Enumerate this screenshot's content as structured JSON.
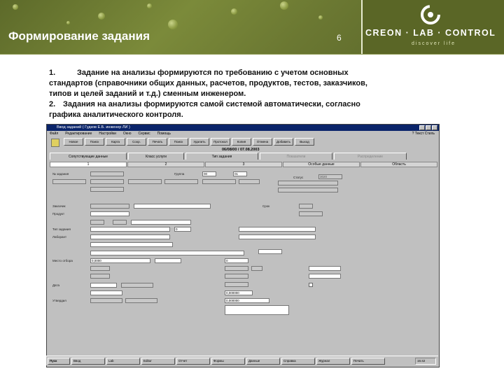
{
  "slide": {
    "title": "Формирование задания",
    "page_number": "6",
    "logo": "CREON · LAB · CONTROL",
    "logo_sub": "discover life",
    "item1_num": "1.",
    "item1_text": "Задание на анализы формируются по требованию с учетом основных стандартов (справочники общих данных, расчетов, продуктов, тестов, заказчиков, типов и целей заданий и т.д.) сменным инженером.",
    "item2_num": "2.",
    "item2_text": "Задания на анализы формируются самой системой автоматически, согласно графика аналитического контроля."
  },
  "app": {
    "window_title": "Ввод заданий ( Гудков Е.Б. инженер ЛИ )",
    "menu": [
      "Файл",
      "Редактирование",
      "Настройки",
      "Окно",
      "Сервис",
      "Помощь"
    ],
    "menu_right": "? Текст  Стиль",
    "toolbar": [
      "Новое",
      "Поиск",
      "Карта",
      "Сохр.",
      "Печать",
      "Поиск",
      "Удалить",
      "Протокол",
      "Копия",
      "Отмена",
      "Добавить",
      "Выход"
    ],
    "date": "06/08/00 / 07.08.2003",
    "tabs": [
      {
        "label": "Сопутствующие данные",
        "disabled": false
      },
      {
        "label": "Класс услуги",
        "disabled": false
      },
      {
        "label": "Тип задания",
        "disabled": false
      },
      {
        "label": "Показатели",
        "disabled": true
      },
      {
        "label": "Распределение",
        "disabled": true
      }
    ],
    "subtabs": [
      "1",
      "2",
      "3",
      "Особые данные",
      "Область"
    ],
    "labels": {
      "order_no": "№ задания",
      "group": "Группа",
      "status": "Статус",
      "deadline": "Срок",
      "client": "Заказчик",
      "product": "Продукт",
      "type": "Тип задания",
      "analyst": "Лаборант",
      "location": "Место отбора",
      "date": "Дата",
      "approved": "Утвердил"
    },
    "values": {
      "group": "00",
      "code": "01",
      "status": "3020",
      "param1": "0,0000",
      "param2": "0",
      "param3": "0",
      "param4": "0,000000",
      "param5": "0,000000"
    }
  },
  "taskbar": {
    "start": "Пуск",
    "tasks": [
      "Ввод",
      "Lab",
      "Editor",
      "Отчет",
      "Формы",
      "Данные",
      "Справка",
      "Журнал",
      "Печать",
      "Сеть"
    ],
    "clock": "15:42"
  },
  "colors": {
    "banner": "#6b7832",
    "titlebar": "#0a246a",
    "window_bg": "#c0c0c0"
  }
}
